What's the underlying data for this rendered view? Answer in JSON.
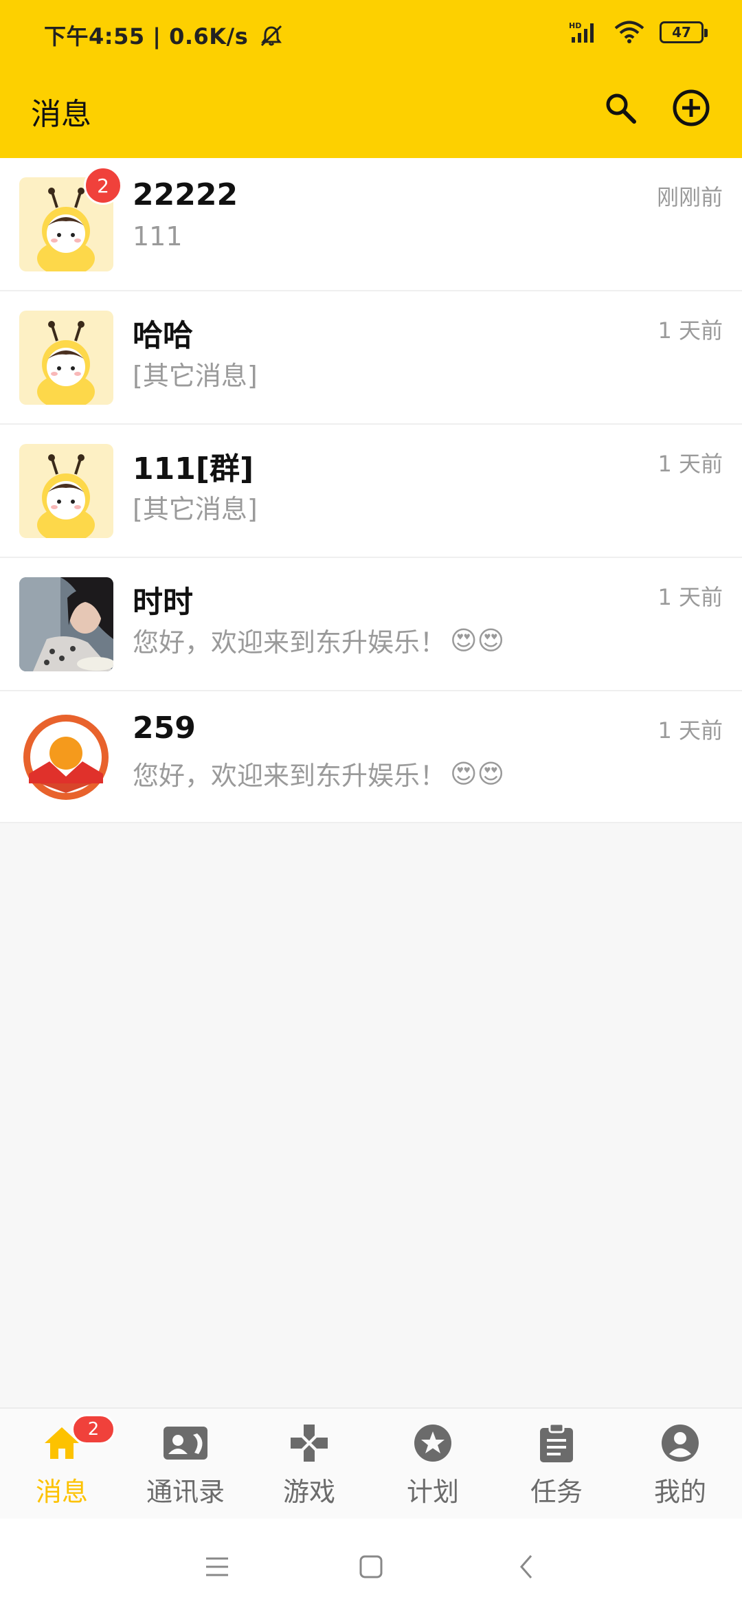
{
  "status_bar": {
    "time_text": "下午4:55 | 0.6K/s",
    "network_label": "HD",
    "battery": "47"
  },
  "app_bar": {
    "title": "消息",
    "search_icon": "search-icon",
    "add_icon": "add-circle-icon"
  },
  "conversations": [
    {
      "name": "22222",
      "preview": "111",
      "time": "刚刚前",
      "unread": "2",
      "avatar": "bee-avatar"
    },
    {
      "name": "哈哈",
      "preview": "[其它消息]",
      "time": "1 天前",
      "avatar": "bee-avatar"
    },
    {
      "name": "111[群]",
      "preview": "[其它消息]",
      "time": "1 天前",
      "avatar": "bee-avatar"
    },
    {
      "name": "时时",
      "preview": "您好，欢迎来到东升娱乐！",
      "emoji": "😍😍",
      "time": "1 天前",
      "avatar": "photo-avatar"
    },
    {
      "name": "259",
      "preview": "您好，欢迎来到东升娱乐！",
      "emoji": "😍😍",
      "time": "1 天前",
      "avatar": "sun-logo-avatar"
    }
  ],
  "bottom_nav": [
    {
      "label": "消息",
      "icon": "home-icon",
      "badge": "2",
      "active": true
    },
    {
      "label": "通讯录",
      "icon": "contacts-icon"
    },
    {
      "label": "游戏",
      "icon": "gamepad-icon"
    },
    {
      "label": "计划",
      "icon": "star-icon"
    },
    {
      "label": "任务",
      "icon": "clipboard-icon"
    },
    {
      "label": "我的",
      "icon": "account-icon"
    }
  ],
  "colors": {
    "header_bg": "#fdd000",
    "active_nav": "#fdc200",
    "badge": "#f0413b"
  }
}
